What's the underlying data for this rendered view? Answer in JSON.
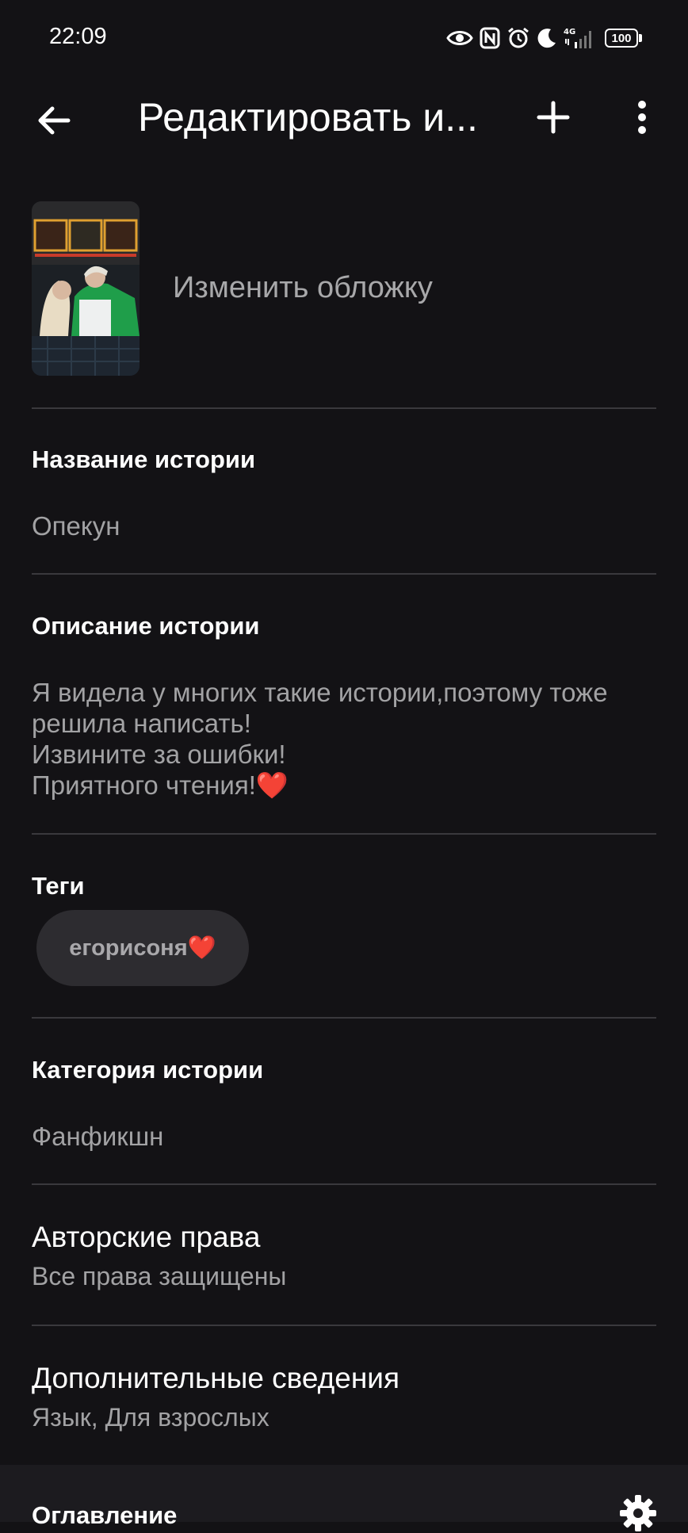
{
  "status": {
    "time": "22:09",
    "network": "4G",
    "battery": "100"
  },
  "toolbar": {
    "title": "Редактировать и...",
    "back_icon": "arrow-left-icon",
    "add_icon": "plus-icon",
    "more_icon": "more-vertical-icon"
  },
  "cover": {
    "change_label": "Изменить обложку"
  },
  "story_title": {
    "label": "Название истории",
    "value": "Опекун"
  },
  "story_description": {
    "label": "Описание истории",
    "lines": [
      "Я видела у многих такие истории,поэтому тоже",
      "решила написать!",
      "Извините за ошибки!",
      "Приятного чтения!"
    ],
    "emoji": "❤️"
  },
  "tags": {
    "label": "Теги",
    "items": [
      {
        "text": "егорисоня",
        "emoji": "❤️"
      }
    ]
  },
  "category": {
    "label": "Категория истории",
    "value": "Фанфикшн"
  },
  "copyright": {
    "label": "Авторские права",
    "value": "Все права защищены"
  },
  "extra_info": {
    "label": "Дополнительные сведения",
    "value": "Язык, Для взрослых"
  },
  "toc": {
    "label": "Оглавление",
    "icon": "gear-icon"
  },
  "colors": {
    "background": "#131215",
    "divider": "#3a393d",
    "secondary_text": "#a2a2a4",
    "chip": "#2d2c30",
    "heart": "#d03a3a"
  }
}
